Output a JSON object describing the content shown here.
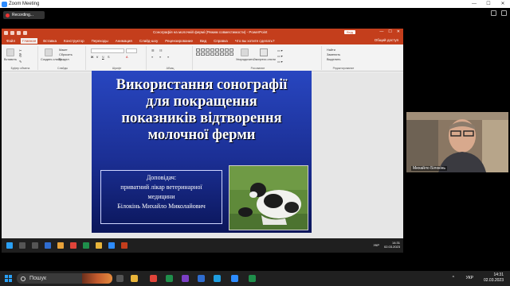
{
  "zoom": {
    "window_title": "Zoom Meeting",
    "recording_label": "Recording..."
  },
  "powerpoint": {
    "doc_title": "Сонографія на молочній фермі (Режим совместимости) - PowerPoint",
    "signin_label": "Вхід",
    "tabs": [
      "Файл",
      "Главная",
      "Вставка",
      "Конструктор",
      "Переходы",
      "Анимация",
      "Слайд-шоу",
      "Рецензирование",
      "Вид",
      "Справка",
      "Что вы хотите сделать?"
    ],
    "active_tab": "Главная",
    "share_label": "Общий доступ",
    "ribbon": {
      "paste_label": "Вставить",
      "create_slide_label": "Создать слайд",
      "layout_label": "Макет",
      "reset_label": "Сбросить",
      "section_label": "Раздел",
      "arrange_label": "Упорядочить",
      "quick_styles_label": "Экспресс-стили",
      "find_label": "Найти",
      "replace_label": "Заменить",
      "select_label": "Выделить",
      "group_labels": [
        "Буфер обмена",
        "Слайды",
        "Шрифт",
        "Абзац",
        "Рисование",
        "Редактирование"
      ]
    },
    "slide": {
      "title_lines": [
        "Використання сонографії",
        "для покращення",
        "показників відтворення",
        "молочної ферми"
      ],
      "speaker_label": "Доповідач:",
      "speaker_lines": [
        "приватний лікар ветеринарної",
        "медицини",
        "Білокінь Михайло Миколайович"
      ]
    },
    "status": {
      "slide_counter": "Слайд 1 из 17",
      "language": "русский",
      "notes_label": "Примечания",
      "zoom_level": "47%"
    },
    "remote_taskbar": {
      "lang": "УКР",
      "time": "14:31",
      "date": "02.03.2023"
    }
  },
  "video": {
    "participant_name": "Михайло Білокінь"
  },
  "taskbar": {
    "search_placeholder": "Пошук",
    "tray_chevron": "^",
    "lang": "УКР",
    "time": "14:31",
    "date": "02.03.2023"
  },
  "colors": {
    "ppt_accent": "#c43e1c",
    "slide_bg_top": "#2846c0",
    "slide_bg_bottom": "#0b165a",
    "zoom_blue": "#2d8cff"
  }
}
